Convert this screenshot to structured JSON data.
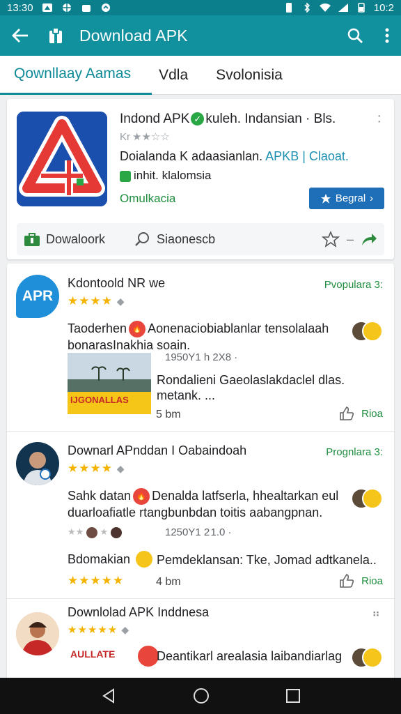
{
  "status_bar": {
    "time": "13:30",
    "battery": "10:2"
  },
  "app_bar": {
    "title": "Download APK"
  },
  "tabs": [
    "Qownllaay Aamas",
    "Vdla",
    "Svolonisia"
  ],
  "hero": {
    "title": "Indond APK",
    "title_suffix": "kuleh. Indansian · Bls.",
    "rating_text": "Kr ★★☆☆",
    "line2": "Doialanda K adaasianlan.",
    "line2_link": "APKB | Claoat.",
    "line3": "inhit. klalomsia",
    "line4": "Omulkacia",
    "cta_label": "Begral",
    "action_download": "Dowaloork",
    "action_search": "Siaonescb",
    "logo_letter": "A"
  },
  "feed": [
    {
      "avatar_text": "APR",
      "title": "Kdontoold NR we",
      "popular": "Pvopulara 3:",
      "stars": "★★★★",
      "desc": "Taoderhen",
      "desc_rest": "Aonenaciobiablanlar tensolalaah bonarasInakhia soain.",
      "meta": "1950Y1 h 2X8 ·",
      "sub": "Rondalieni Gaeolaslakdaclel dlas. metank. ...",
      "thumb_caption": "IJGONALLAS",
      "time": "5 bm",
      "like": "Rioa"
    },
    {
      "title": "Downarl APnddan I Oabaindoah",
      "popular": "Prognlara 3:",
      "stars": "★★★★",
      "desc": "Sahk datan",
      "desc_rest": "Denalda latfserla, hhealtarkan eul duarloafiatle rtangbunbdan toitis aabangpnan.",
      "meta": "1250Y1 2 1.0 ·",
      "sub_left": "Bdomakian",
      "sub": "Pemdeklansan: Tke, Jomad adtkanela..",
      "time": "4 bm",
      "like": "Rioa"
    },
    {
      "title": "Downlolad APK Inddnesa",
      "stars": "★★★★★",
      "thumb_caption": "AULLATE",
      "desc_rest": "Deantikarl arealasia laibandiarlag"
    }
  ]
}
